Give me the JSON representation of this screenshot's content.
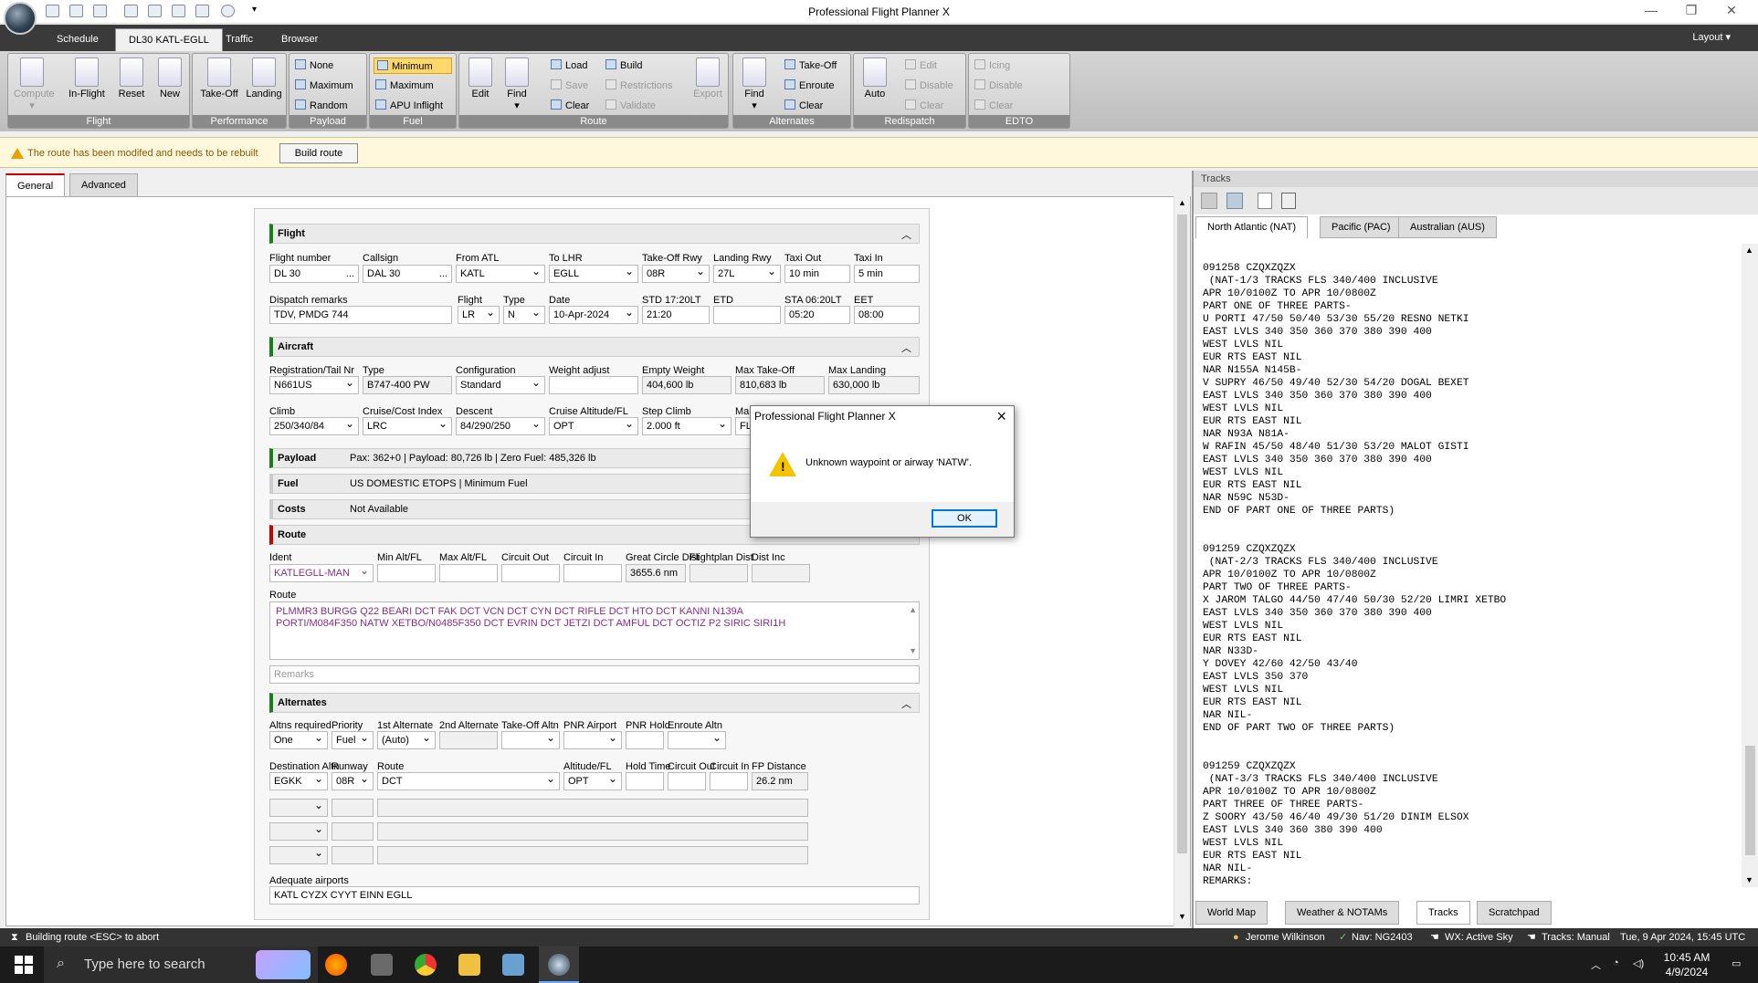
{
  "app": {
    "title": "Professional Flight Planner X",
    "layout": "Layout"
  },
  "menu": {
    "tabs": [
      "Schedule",
      "DL30 KATL-EGLL",
      "Traffic",
      "Browser"
    ]
  },
  "ribbon": {
    "flight": {
      "label": "Flight",
      "buttons": [
        "Compute",
        "In-Flight",
        "Reset",
        "New"
      ]
    },
    "performance": {
      "label": "Performance",
      "buttons": [
        "Take-Off",
        "Landing"
      ]
    },
    "payload": {
      "label": "Payload",
      "buttons": [
        "None",
        "Maximum",
        "Random"
      ]
    },
    "fuel": {
      "label": "Fuel",
      "buttons": [
        "Minimum",
        "Maximum",
        "APU Inflight"
      ]
    },
    "route": {
      "label": "Route",
      "big": [
        "Edit",
        "Find"
      ],
      "small": [
        "Load",
        "Save",
        "Clear",
        "Build",
        "Restrictions",
        "Validate"
      ],
      "export": "Export"
    },
    "alternates": {
      "label": "Alternates",
      "big": "Find",
      "small": [
        "Take-Off",
        "Enroute",
        "Clear"
      ]
    },
    "redispatch": {
      "label": "Redispatch",
      "big": "Auto",
      "small": [
        "Edit",
        "Disable",
        "Clear"
      ]
    },
    "edto": {
      "label": "EDTO",
      "small": [
        "Icing",
        "Disable",
        "Clear"
      ]
    }
  },
  "warning": {
    "text": "The route has been modifed and needs to be rebuilt",
    "button": "Build route"
  },
  "panel_tabs": [
    "General",
    "Advanced"
  ],
  "flight": {
    "header": "Flight",
    "labels": [
      "Flight number",
      "Callsign",
      "From ATL",
      "To LHR",
      "Take-Off Rwy",
      "Landing Rwy",
      "Taxi Out",
      "Taxi In"
    ],
    "values": [
      "DL 30",
      "DAL 30",
      "KATL",
      "EGLL",
      "08R",
      "27L",
      "10 min",
      "5 min"
    ],
    "labels2": [
      "Dispatch remarks",
      "Flight",
      "Type",
      "Date",
      "STD 17:20LT",
      "ETD",
      "STA 06:20LT",
      "EET"
    ],
    "values2": [
      "TDV, PMDG 744",
      "LR",
      "N",
      "10-Apr-2024",
      "21:20",
      "",
      "05:20",
      "08:00"
    ]
  },
  "aircraft": {
    "header": "Aircraft",
    "labels": [
      "Registration/Tail Nr",
      "Type",
      "Configuration",
      "Weight adjust",
      "Empty Weight",
      "Max Take-Off",
      "Max Landing"
    ],
    "values": [
      "N661US",
      "B747-400 PW",
      "Standard",
      "",
      "404,600 lb",
      "810,683 lb",
      "630,000 lb"
    ],
    "labels2": [
      "Climb",
      "Cruise/Cost Index",
      "Descent",
      "Cruise Altitude/FL",
      "Step Climb",
      "Ma"
    ],
    "values2": [
      "250/340/84",
      "LRC",
      "84/290/250",
      "OPT",
      "2.000 ft",
      "FL"
    ]
  },
  "summary": [
    {
      "label": "Payload",
      "text": "Pax: 362+0 | Payload: 80,726 lb | Zero Fuel: 485,326 lb"
    },
    {
      "label": "Fuel",
      "text": "US DOMESTIC ETOPS | Minimum Fuel"
    },
    {
      "label": "Costs",
      "text": "Not Available"
    }
  ],
  "route": {
    "header": "Route",
    "labels": [
      "Ident",
      "Min Alt/FL",
      "Max Alt/FL",
      "Circuit Out",
      "Circuit In",
      "Great Circle Dist",
      "Flightplan Dist",
      "Dist Inc"
    ],
    "ident": "KATLEGLL-MAN",
    "gcd": "3655.6 nm",
    "route_label": "Route",
    "route_line1": "PLMMR3 BURGG Q22 BEARI DCT FAK DCT VCN DCT CYN DCT RIFLE DCT HTO DCT KANNI N139A",
    "route_line2": "PORTI/M084F350 NATW XETBO/N0485F350 DCT EVRIN DCT JETZI DCT AMFUL DCT OCTIZ P2 SIRIC SIRI1H",
    "remarks_placeholder": "Remarks"
  },
  "alternates": {
    "header": "Alternates",
    "labels": [
      "Altns required",
      "Priority",
      "1st Alternate",
      "2nd Alternate",
      "Take-Off Altn",
      "PNR Airport",
      "PNR Hold",
      "Enroute Altn"
    ],
    "values": [
      "One",
      "Fuel",
      "(Auto)"
    ],
    "labels2": [
      "Destination Altn",
      "Runway",
      "Route",
      "Altitude/FL",
      "Hold Time",
      "Circuit Out",
      "Circuit In",
      "FP Distance"
    ],
    "values2": [
      "EGKK",
      "08R",
      "DCT",
      "OPT",
      "26.2 nm"
    ],
    "adequate_label": "Adequate airports",
    "adequate": "KATL CYZX CYYT EINN EGLL"
  },
  "tracks": {
    "title": "Tracks",
    "tabs": [
      "North Atlantic (NAT)",
      "Pacific (PAC)",
      "Australian (AUS)"
    ],
    "text": "091258 CZQXZQZX\n (NAT-1/3 TRACKS FLS 340/400 INCLUSIVE\nAPR 10/0100Z TO APR 10/0800Z\nPART ONE OF THREE PARTS-\nU PORTI 47/50 50/40 53/30 55/20 RESNO NETKI\nEAST LVLS 340 350 360 370 380 390 400\nWEST LVLS NIL\nEUR RTS EAST NIL\nNAR N155A N145B-\nV SUPRY 46/50 49/40 52/30 54/20 DOGAL BEXET\nEAST LVLS 340 350 360 370 380 390 400\nWEST LVLS NIL\nEUR RTS EAST NIL\nNAR N93A N81A-\nW RAFIN 45/50 48/40 51/30 53/20 MALOT GISTI\nEAST LVLS 340 350 360 370 380 390 400\nWEST LVLS NIL\nEUR RTS EAST NIL\nNAR N59C N53D-\nEND OF PART ONE OF THREE PARTS)\n\n\n091259 CZQXZQZX\n (NAT-2/3 TRACKS FLS 340/400 INCLUSIVE\nAPR 10/0100Z TO APR 10/0800Z\nPART TWO OF THREE PARTS-\nX JAROM TALGO 44/50 47/40 50/30 52/20 LIMRI XETBO\nEAST LVLS 340 350 360 370 380 390 400\nWEST LVLS NIL\nEUR RTS EAST NIL\nNAR N33D-\nY DOVEY 42/60 42/50 43/40\nEAST LVLS 350 370\nWEST LVLS NIL\nEUR RTS EAST NIL\nNAR NIL-\nEND OF PART TWO OF THREE PARTS)\n\n\n091259 CZQXZQZX\n (NAT-3/3 TRACKS FLS 340/400 INCLUSIVE\nAPR 10/0100Z TO APR 10/0800Z\nPART THREE OF THREE PARTS-\nZ SOORY 43/50 46/40 49/30 51/20 DINIM ELSOX\nEAST LVLS 340 360 380 390 400\nWEST LVLS NIL\nEUR RTS EAST NIL\nNAR NIL-\nREMARKS:",
    "bottom_tabs": [
      "World Map",
      "Weather & NOTAMs",
      "Tracks",
      "Scratchpad"
    ]
  },
  "status": {
    "left": "Building route <ESC> to abort",
    "user": "Jerome Wilkinson",
    "nav": "Nav: NG2403",
    "wx": "WX: Active Sky",
    "tracks": "Tracks: Manual",
    "time": "Tue, 9 Apr 2024, 15:45 UTC"
  },
  "taskbar": {
    "search": "Type here to search",
    "clock": "10:45 AM",
    "date": "4/9/2024"
  },
  "dialog": {
    "title": "Professional Flight Planner X",
    "message": "Unknown waypoint or airway 'NATW'.",
    "ok": "OK"
  }
}
